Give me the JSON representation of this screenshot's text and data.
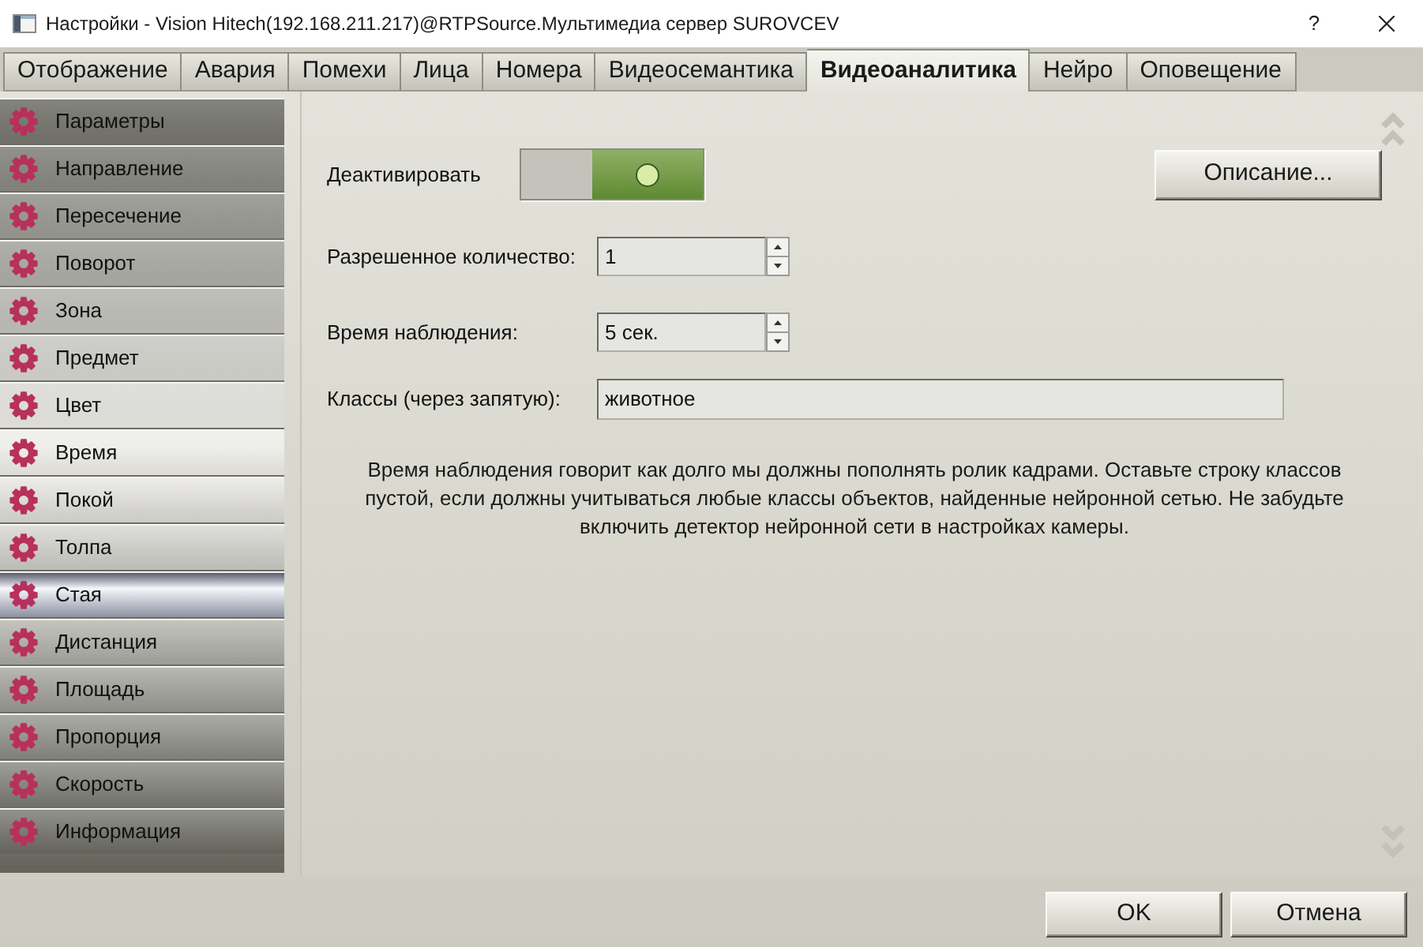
{
  "window": {
    "title": "Настройки - Vision Hitech(192.168.211.217)@RTPSource.Мультимедиа сервер SUROVCEV",
    "help_button": "?"
  },
  "tabs": [
    {
      "label": "Отображение",
      "selected": false
    },
    {
      "label": "Авария",
      "selected": false
    },
    {
      "label": "Помехи",
      "selected": false
    },
    {
      "label": "Лица",
      "selected": false
    },
    {
      "label": "Номера",
      "selected": false
    },
    {
      "label": "Видеосемантика",
      "selected": false
    },
    {
      "label": "Видеоаналитика",
      "selected": true
    },
    {
      "label": "Нейро",
      "selected": false
    },
    {
      "label": "Оповещение",
      "selected": false
    }
  ],
  "sidebar": {
    "items": [
      {
        "label": "Параметры",
        "selected": false
      },
      {
        "label": "Направление",
        "selected": false
      },
      {
        "label": "Пересечение",
        "selected": false
      },
      {
        "label": "Поворот",
        "selected": false
      },
      {
        "label": "Зона",
        "selected": false
      },
      {
        "label": "Предмет",
        "selected": false
      },
      {
        "label": "Цвет",
        "selected": false
      },
      {
        "label": "Время",
        "selected": false
      },
      {
        "label": "Покой",
        "selected": false
      },
      {
        "label": "Толпа",
        "selected": false
      },
      {
        "label": "Стая",
        "selected": true
      },
      {
        "label": "Дистанция",
        "selected": false
      },
      {
        "label": "Площадь",
        "selected": false
      },
      {
        "label": "Пропорция",
        "selected": false
      },
      {
        "label": "Скорость",
        "selected": false
      },
      {
        "label": "Информация",
        "selected": false
      }
    ]
  },
  "panel": {
    "deactivate": {
      "label": "Деактивировать",
      "on": true
    },
    "description_button": "Описание...",
    "fields": [
      {
        "kind": "spin",
        "label": "Разрешенное количество:",
        "value": "1"
      },
      {
        "kind": "spin",
        "label": "Время наблюдения:",
        "value": "5 сек."
      },
      {
        "kind": "text",
        "label": "Классы (через запятую):",
        "value": "животное"
      }
    ],
    "hint": "Время наблюдения говорит как долго мы должны пополнять ролик кадрами. Оставьте строку классов пустой, если должны учитываться любые классы объектов, найденные нейронной сетью. Не забудьте включить детектор нейронной сети в настройках камеры."
  },
  "buttons": [
    "OK",
    "Отмена"
  ]
}
